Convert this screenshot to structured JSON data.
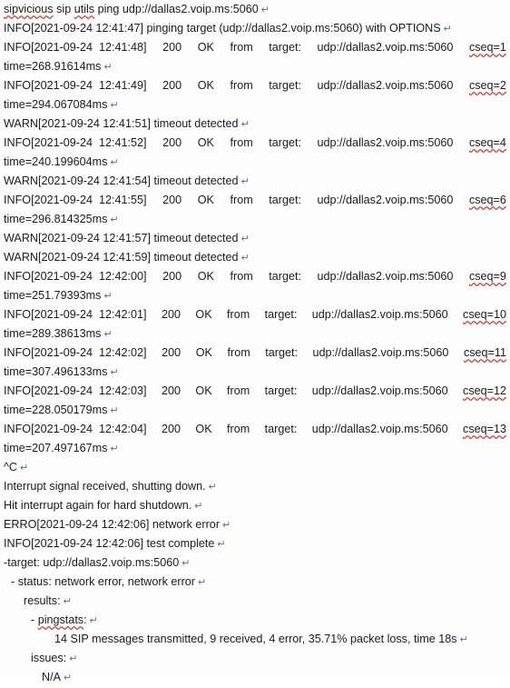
{
  "document": {
    "type": "terminal-log-transcript",
    "marks": {
      "pilcrow": "↵"
    },
    "command": {
      "prefix": "sipvicious",
      "rest": " sip ",
      "utils": "utils",
      "tail": " ping udp://dallas2.voip.ms:5060"
    },
    "lines": [
      {
        "id": "cmd",
        "kind": "command",
        "text": "sipvicious sip utils ping udp://dallas2.voip.ms:5060"
      },
      {
        "id": "ping-start",
        "kind": "plain",
        "text": "INFO[2021-09-24 12:41:47] pinging target (udp://dallas2.voip.ms:5060) with OPTIONS"
      },
      {
        "id": "resp-1",
        "kind": "justified",
        "level": "INFO",
        "timestamp": "INFO[2021-09-24",
        "time": "12:41:48]",
        "code": "200",
        "status": "OK",
        "from": "from",
        "target_label": "target:",
        "target": "udp://dallas2.voip.ms:5060",
        "cseq": "cseq=1"
      },
      {
        "id": "time-1",
        "kind": "plain",
        "text": "time=268.91614ms"
      },
      {
        "id": "resp-2",
        "kind": "justified",
        "level": "INFO",
        "timestamp": "INFO[2021-09-24",
        "time": "12:41:49]",
        "code": "200",
        "status": "OK",
        "from": "from",
        "target_label": "target:",
        "target": "udp://dallas2.voip.ms:5060",
        "cseq": "cseq=2"
      },
      {
        "id": "time-2",
        "kind": "plain",
        "text": "time=294.067084ms"
      },
      {
        "id": "warn-1",
        "kind": "plain",
        "text": "WARN[2021-09-24 12:41:51] timeout detected"
      },
      {
        "id": "resp-4",
        "kind": "justified",
        "level": "INFO",
        "timestamp": "INFO[2021-09-24",
        "time": "12:41:52]",
        "code": "200",
        "status": "OK",
        "from": "from",
        "target_label": "target:",
        "target": "udp://dallas2.voip.ms:5060",
        "cseq": "cseq=4"
      },
      {
        "id": "time-4",
        "kind": "plain",
        "text": "time=240.199604ms"
      },
      {
        "id": "warn-2",
        "kind": "plain",
        "text": "WARN[2021-09-24 12:41:54] timeout detected"
      },
      {
        "id": "resp-6",
        "kind": "justified",
        "level": "INFO",
        "timestamp": "INFO[2021-09-24",
        "time": "12:41:55]",
        "code": "200",
        "status": "OK",
        "from": "from",
        "target_label": "target:",
        "target": "udp://dallas2.voip.ms:5060",
        "cseq": "cseq=6"
      },
      {
        "id": "time-6",
        "kind": "plain",
        "text": "time=296.814325ms"
      },
      {
        "id": "warn-3",
        "kind": "plain",
        "text": "WARN[2021-09-24 12:41:57] timeout detected"
      },
      {
        "id": "warn-4",
        "kind": "plain",
        "text": "WARN[2021-09-24 12:41:59] timeout detected"
      },
      {
        "id": "resp-9",
        "kind": "justified",
        "level": "INFO",
        "timestamp": "INFO[2021-09-24",
        "time": "12:42:00]",
        "code": "200",
        "status": "OK",
        "from": "from",
        "target_label": "target:",
        "target": "udp://dallas2.voip.ms:5060",
        "cseq": "cseq=9"
      },
      {
        "id": "time-9",
        "kind": "plain",
        "text": "time=251.79393ms"
      },
      {
        "id": "resp-10",
        "kind": "justified",
        "level": "INFO",
        "timestamp": "INFO[2021-09-24",
        "time": "12:42:01]",
        "code": "200",
        "status": "OK",
        "from": "from",
        "target_label": "target:",
        "target": "udp://dallas2.voip.ms:5060",
        "cseq": "cseq=10"
      },
      {
        "id": "time-10",
        "kind": "plain",
        "text": "time=289.38613ms"
      },
      {
        "id": "resp-11",
        "kind": "justified",
        "level": "INFO",
        "timestamp": "INFO[2021-09-24",
        "time": "12:42:02]",
        "code": "200",
        "status": "OK",
        "from": "from",
        "target_label": "target:",
        "target": "udp://dallas2.voip.ms:5060",
        "cseq": "cseq=11"
      },
      {
        "id": "time-11",
        "kind": "plain",
        "text": "time=307.496133ms"
      },
      {
        "id": "resp-12",
        "kind": "justified",
        "level": "INFO",
        "timestamp": "INFO[2021-09-24",
        "time": "12:42:03]",
        "code": "200",
        "status": "OK",
        "from": "from",
        "target_label": "target:",
        "target": "udp://dallas2.voip.ms:5060",
        "cseq": "cseq=12"
      },
      {
        "id": "time-12",
        "kind": "plain",
        "text": "time=228.050179ms"
      },
      {
        "id": "resp-13",
        "kind": "justified",
        "level": "INFO",
        "timestamp": "INFO[2021-09-24",
        "time": "12:42:04]",
        "code": "200",
        "status": "OK",
        "from": "from",
        "target_label": "target:",
        "target": "udp://dallas2.voip.ms:5060",
        "cseq": "cseq=13"
      },
      {
        "id": "time-13",
        "kind": "plain",
        "text": "time=207.497167ms"
      },
      {
        "id": "sigint",
        "kind": "plain",
        "text": "^C"
      },
      {
        "id": "interrupt",
        "kind": "plain",
        "text": "Interrupt signal received, shutting down."
      },
      {
        "id": "hit-interrupt",
        "kind": "plain",
        "text": "Hit interrupt again for hard shutdown."
      },
      {
        "id": "error",
        "kind": "plain",
        "text": "ERRO[2021-09-24 12:42:06] network error"
      },
      {
        "id": "complete",
        "kind": "plain",
        "text": "INFO[2021-09-24 12:42:06] test complete"
      },
      {
        "id": "target",
        "kind": "plain",
        "text": "-target: udp://dallas2.voip.ms:5060"
      },
      {
        "id": "status",
        "kind": "plain",
        "text": "- status: network error, network error"
      },
      {
        "id": "results",
        "kind": "plain",
        "text": "results:"
      },
      {
        "id": "pingstats",
        "kind": "plain",
        "text": "- pingstats:"
      },
      {
        "id": "pingstats-value",
        "kind": "plain",
        "text": "14 SIP messages transmitted, 9 received, 4 error, 35.71% packet loss, time 18s"
      },
      {
        "id": "issues",
        "kind": "plain",
        "text": "issues:"
      },
      {
        "id": "issues-value",
        "kind": "plain",
        "text": "N/A"
      }
    ],
    "summary": {
      "transmitted": 14,
      "received": 9,
      "errors": 4,
      "packet_loss": "35.71%",
      "duration": "18s",
      "status": "network error, network error",
      "target": "udp://dallas2.voip.ms:5060"
    },
    "colors": {
      "text": "#1b1b1b",
      "pilcrow": "#4f6fa8",
      "spellcheck": "#d43a2f",
      "background": "#fdfdfd"
    }
  }
}
